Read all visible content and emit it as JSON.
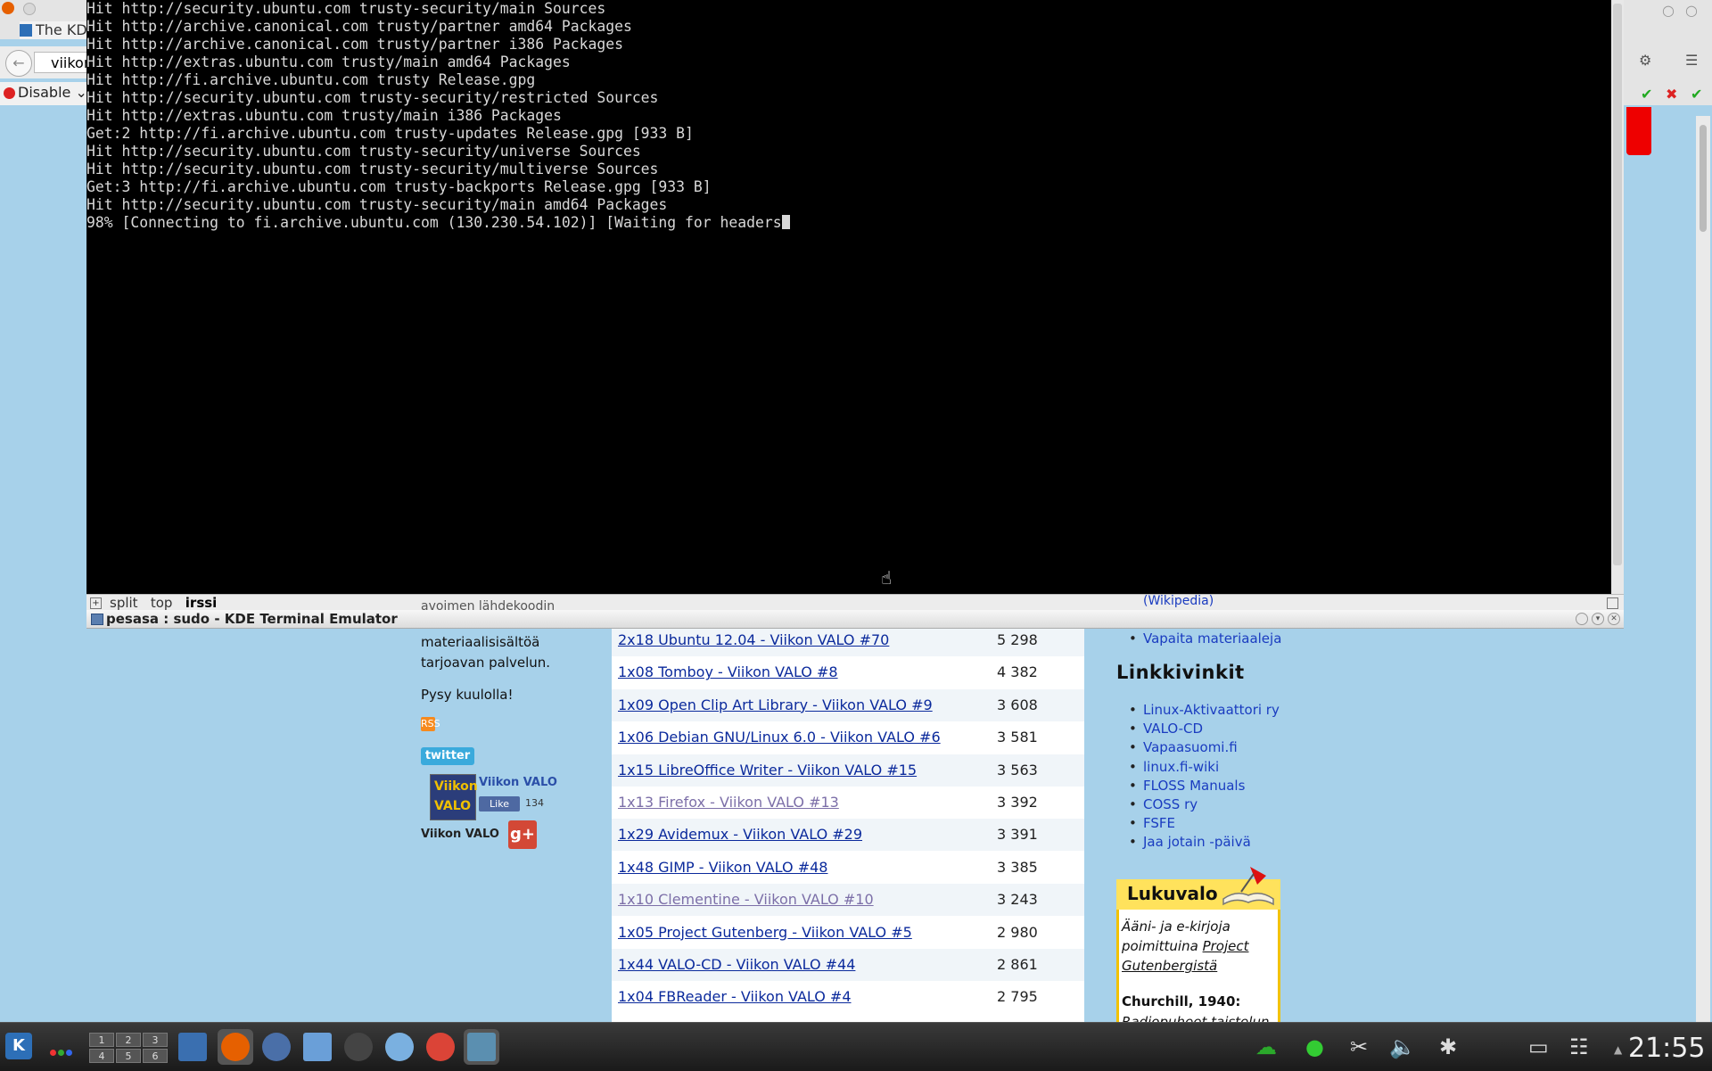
{
  "browser": {
    "tab_title": "The KD",
    "url": "viikor",
    "disable_label": "Disable"
  },
  "terminal": {
    "lines": [
      "Hit http://security.ubuntu.com trusty-security/main Sources",
      "Hit http://archive.canonical.com trusty/partner amd64 Packages",
      "Hit http://archive.canonical.com trusty/partner i386 Packages",
      "Hit http://extras.ubuntu.com trusty/main amd64 Packages",
      "Hit http://fi.archive.ubuntu.com trusty Release.gpg",
      "Hit http://security.ubuntu.com trusty-security/restricted Sources",
      "Hit http://extras.ubuntu.com trusty/main i386 Packages",
      "Get:2 http://fi.archive.ubuntu.com trusty-updates Release.gpg [933 B]",
      "Hit http://security.ubuntu.com trusty-security/universe Sources",
      "Hit http://security.ubuntu.com trusty-security/multiverse Sources",
      "Get:3 http://fi.archive.ubuntu.com trusty-backports Release.gpg [933 B]",
      "Hit http://security.ubuntu.com trusty-security/main amd64 Packages"
    ],
    "progress_line": "98% [Connecting to fi.archive.ubuntu.com (130.230.54.102)] [Waiting for headers",
    "tabs": [
      "split",
      "top"
    ],
    "active_tab": "irssi",
    "window_title": "pesasa : sudo - KDE Terminal Emulator"
  },
  "page": {
    "overlap_left": "avoimen lähdekoodin",
    "overlap_right": "(Wikipedia)",
    "left_text": [
      "materiaalisisältöä",
      "tarjoavan palvelun.",
      "Pysy kuulolla!"
    ],
    "rss": "RSS",
    "twitter": "twitter",
    "vv_logo": [
      "Viikon",
      "VALO"
    ],
    "vv_name": "Viikon VALO",
    "fb_like": "Like",
    "fb_count": "134",
    "vv_label": "Viikon VALO",
    "gplus": "g+",
    "episodes": [
      {
        "title": "2x18 Ubuntu 12.04 - Viikon VALO #70",
        "count": "5 298"
      },
      {
        "title": "1x08 Tomboy - Viikon VALO #8",
        "count": "4 382"
      },
      {
        "title": "1x09 Open Clip Art Library - Viikon VALO #9",
        "count": "3 608"
      },
      {
        "title": "1x06 Debian GNU/Linux 6.0 - Viikon VALO #6",
        "count": "3 581"
      },
      {
        "title": "1x15 LibreOffice Writer - Viikon VALO #15",
        "count": "3 563"
      },
      {
        "title": "1x13 Firefox - Viikon VALO #13",
        "count": "3 392"
      },
      {
        "title": "1x29 Avidemux - Viikon VALO #29",
        "count": "3 391"
      },
      {
        "title": "1x48 GIMP - Viikon VALO #48",
        "count": "3 385"
      },
      {
        "title": "1x10 Clementine - Viikon VALO #10",
        "count": "3 243"
      },
      {
        "title": "1x05 Project Gutenberg - Viikon VALO #5",
        "count": "2 980"
      },
      {
        "title": "1x44 VALO-CD - Viikon VALO #44",
        "count": "2 861"
      },
      {
        "title": "1x04 FBReader - Viikon VALO #4",
        "count": "2 795"
      }
    ],
    "vapaita": "Vapaita materiaaleja",
    "links_title": "Linkkivinkit",
    "links": [
      "Linux-Aktivaattori ry",
      "VALO-CD",
      "Vapaasuomi.fi",
      "linux.fi-wiki",
      "FLOSS Manuals",
      "COSS ry",
      "FSFE",
      "Jaa jotain -päivä"
    ],
    "lukuvalo_title": "Lukuvalo",
    "lukuvalo_l1": "Ääni- ja e-kirjoja",
    "lukuvalo_l2a": "poimittuina ",
    "lukuvalo_l2b": "Project",
    "lukuvalo_l3": "Gutenbergistä",
    "lukuvalo_book": "Churchill, 1940:",
    "lukuvalo_sub": "Radiopuheet taistelun"
  },
  "taskbar": {
    "pager": [
      "1",
      "2",
      "3",
      "4",
      "5",
      "6"
    ],
    "clock": "21:55"
  }
}
